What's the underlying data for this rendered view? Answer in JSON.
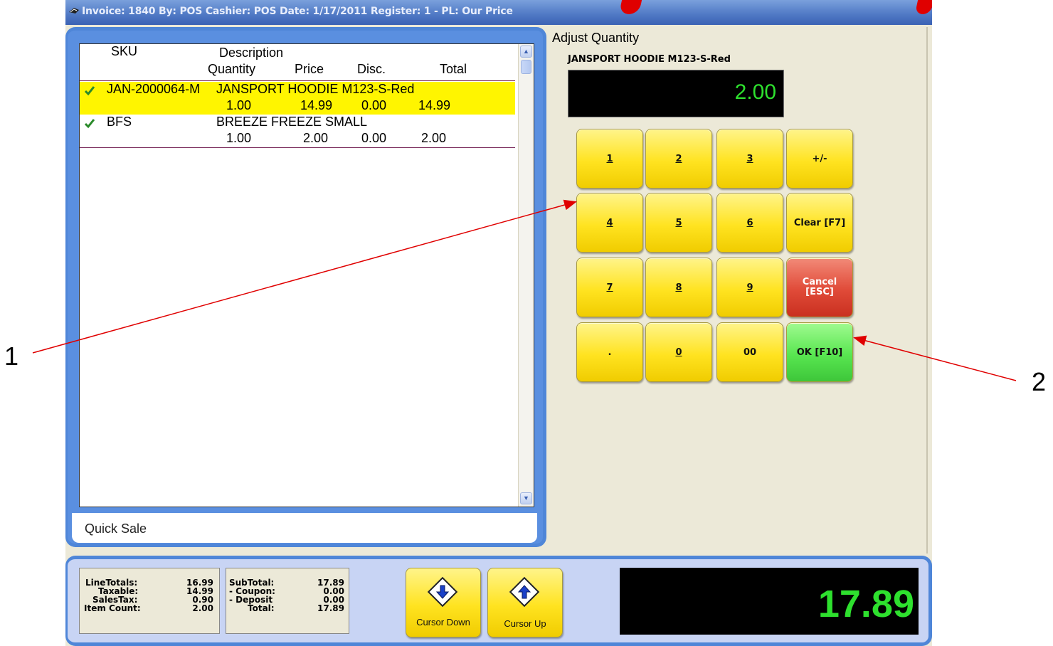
{
  "titlebar": {
    "text": "Invoice: 1840  By: POS  Cashier: POS   Date:  1/17/2011  Register: 1 - PL: Our Price"
  },
  "list": {
    "headers": {
      "sku": "SKU",
      "description": "Description",
      "quantity": "Quantity",
      "price": "Price",
      "disc": "Disc.",
      "total": "Total"
    },
    "rows": [
      {
        "sku": "JAN-2000064-M",
        "description": "JANSPORT HOODIE M123-S-Red",
        "quantity": "1.00",
        "price": "14.99",
        "disc": "0.00",
        "total": "14.99",
        "selected": true
      },
      {
        "sku": "BFS",
        "description": "BREEZE FREEZE SMALL",
        "quantity": "1.00",
        "price": "2.00",
        "disc": "0.00",
        "total": "2.00",
        "selected": false
      }
    ],
    "footer": "Quick Sale"
  },
  "adjust": {
    "title": "Adjust Quantity",
    "item_name": "JANSPORT HOODIE M123-S-Red",
    "display_value": "2.00",
    "keys": [
      "1",
      "2",
      "3",
      "+/-",
      "4",
      "5",
      "6",
      "Clear [F7]",
      "7",
      "8",
      "9",
      "Cancel\n[ESC]",
      ".",
      "0",
      "00",
      "OK [F10]"
    ]
  },
  "totals": {
    "left": [
      {
        "label": "LineTotals:",
        "value": "16.99"
      },
      {
        "label": "Taxable:",
        "value": "14.99"
      },
      {
        "label": "SalesTax:",
        "value": "0.90"
      },
      {
        "label": "Item Count:",
        "value": "2.00"
      }
    ],
    "right": [
      {
        "label": "SubTotal:",
        "value": "17.89"
      },
      {
        "label": "- Coupon:",
        "value": "0.00"
      },
      {
        "label": "- Deposit",
        "value": "0.00"
      },
      {
        "label": "Total:",
        "value": "17.89"
      }
    ]
  },
  "bottom_buttons": {
    "cursor_down": "Cursor Down",
    "cursor_up": "Cursor Up"
  },
  "grand_total": "17.89",
  "annotations": {
    "label_1": "1",
    "label_2": "2"
  },
  "colors": {
    "accent_blue": "#4f86d8",
    "display_green": "#2ee02e",
    "selected_row": "#fff500",
    "key_yellow": "#ffe320",
    "key_red": "#e04a38",
    "key_green": "#58e650"
  },
  "icons": {
    "check": "check-icon",
    "arrow_down": "arrow-down-diamond-icon",
    "arrow_up": "arrow-up-diamond-icon"
  }
}
